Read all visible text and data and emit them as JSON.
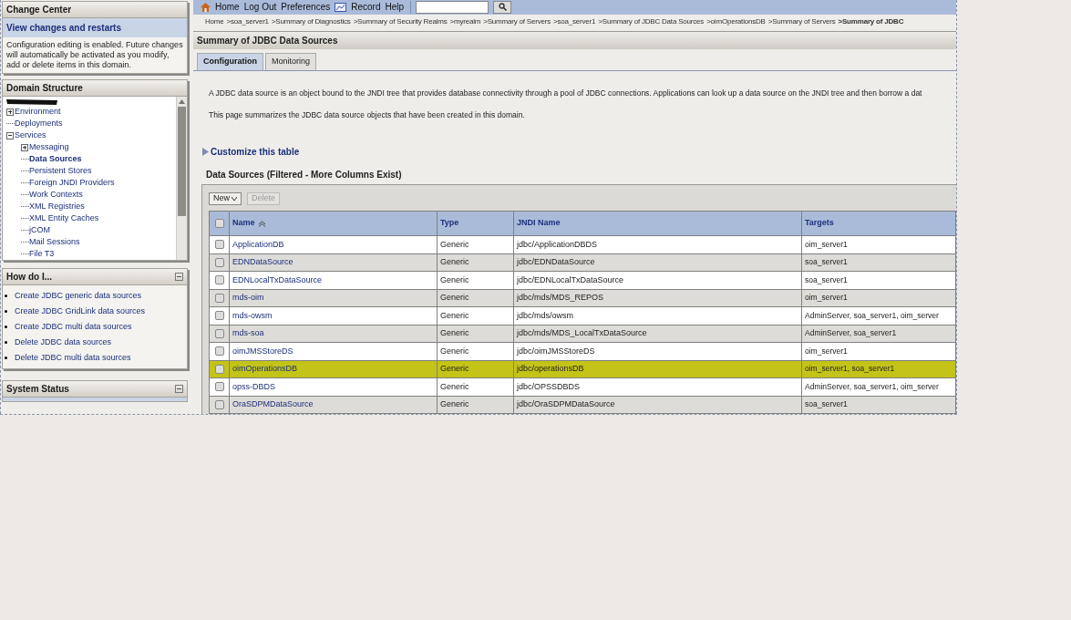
{
  "change_center": {
    "title": "Change Center",
    "link": "View changes and restarts",
    "message": "Configuration editing is enabled. Future changes will automatically be activated as you modify, add or delete items in this domain."
  },
  "domain_structure": {
    "title": "Domain Structure",
    "tree": [
      {
        "label": "Environment",
        "expanded": false,
        "selected": false
      },
      {
        "label": "Deployments",
        "selected": false
      },
      {
        "label": "Services",
        "expanded": true,
        "selected": false,
        "children": [
          {
            "label": "Messaging",
            "expanded": false,
            "selected": false
          },
          {
            "label": "Data Sources",
            "selected": true
          },
          {
            "label": "Persistent Stores",
            "selected": false
          },
          {
            "label": "Foreign JNDI Providers",
            "selected": false
          },
          {
            "label": "Work Contexts",
            "selected": false
          },
          {
            "label": "XML Registries",
            "selected": false
          },
          {
            "label": "XML Entity Caches",
            "selected": false
          },
          {
            "label": "jCOM",
            "selected": false
          },
          {
            "label": "Mail Sessions",
            "selected": false
          },
          {
            "label": "File T3",
            "selected": false
          }
        ]
      }
    ]
  },
  "how_do_i": {
    "title": "How do I...",
    "links": [
      "Create JDBC generic data sources",
      "Create JDBC GridLink data sources",
      "Create JDBC multi data sources",
      "Delete JDBC data sources",
      "Delete JDBC multi data sources"
    ]
  },
  "system_status": {
    "title": "System Status"
  },
  "toolbar": [
    "Home",
    "Log Out",
    "Preferences",
    "Record",
    "Help"
  ],
  "breadcrumb": [
    "Home",
    ">soa_server1",
    ">Summary of Diagnostics",
    ">Summary of Security Realms",
    ">myrealm",
    ">Summary of Servers",
    ">soa_server1",
    ">Summary of JDBC Data Sources",
    ">oimOperationsDB",
    ">Summary of Servers",
    ">Summary of JDBC"
  ],
  "page_title": "Summary of JDBC Data Sources",
  "tabs": [
    {
      "label": "Configuration",
      "selected": true
    },
    {
      "label": "Monitoring",
      "selected": false
    }
  ],
  "description": [
    "A JDBC data source is an object bound to the JNDI tree that provides database connectivity through a pool of JDBC connections. Applications can look up a data source on the JNDI tree and then borrow a dat",
    "This page summarizes the JDBC data source objects that have been created in this domain."
  ],
  "customize_link": "Customize this table",
  "table": {
    "title": "Data Sources (Filtered - More Columns Exist)",
    "buttons": [
      {
        "label": "New",
        "disabled": false
      },
      {
        "label": "Delete",
        "disabled": true
      }
    ],
    "select_all_checked": false,
    "columns": [
      "Name",
      "Type",
      "JNDI Name",
      "Targets"
    ],
    "rows": [
      {
        "name": "ApplicationDB",
        "type": "Generic",
        "jndi": "jdbc/ApplicationDBDS",
        "targets": "oim_server1",
        "highlighted": false,
        "checked": false
      },
      {
        "name": "EDNDataSource",
        "type": "Generic",
        "jndi": "jdbc/EDNDataSource",
        "targets": "soa_server1",
        "highlighted": false,
        "checked": false
      },
      {
        "name": "EDNLocalTxDataSource",
        "type": "Generic",
        "jndi": "jdbc/EDNLocalTxDataSource",
        "targets": "soa_server1",
        "highlighted": false,
        "checked": false
      },
      {
        "name": "mds-oim",
        "type": "Generic",
        "jndi": "jdbc/mds/MDS_REPOS",
        "targets": "oim_server1",
        "highlighted": false,
        "checked": false
      },
      {
        "name": "mds-owsm",
        "type": "Generic",
        "jndi": "jdbc/mds/owsm",
        "targets": "AdminServer, soa_server1, oim_server",
        "highlighted": false,
        "checked": false
      },
      {
        "name": "mds-soa",
        "type": "Generic",
        "jndi": "jdbc/mds/MDS_LocalTxDataSource",
        "targets": "AdminServer, soa_server1",
        "highlighted": false,
        "checked": false
      },
      {
        "name": "oimJMSStoreDS",
        "type": "Generic",
        "jndi": "jdbc/oimJMSStoreDS",
        "targets": "oim_server1",
        "highlighted": false,
        "checked": false
      },
      {
        "name": "oimOperationsDB",
        "type": "Generic",
        "jndi": "jdbc/operationsDB",
        "targets": "oim_server1, soa_server1",
        "highlighted": true,
        "checked": false
      },
      {
        "name": "opss-DBDS",
        "type": "Generic",
        "jndi": "jdbc/OPSSDBDS",
        "targets": "AdminServer, soa_server1, oim_server",
        "highlighted": false,
        "checked": false
      },
      {
        "name": "OraSDPMDataSource",
        "type": "Generic",
        "jndi": "jdbc/OraSDPMDataSource",
        "targets": "soa_server1",
        "highlighted": false,
        "checked": false
      }
    ]
  }
}
